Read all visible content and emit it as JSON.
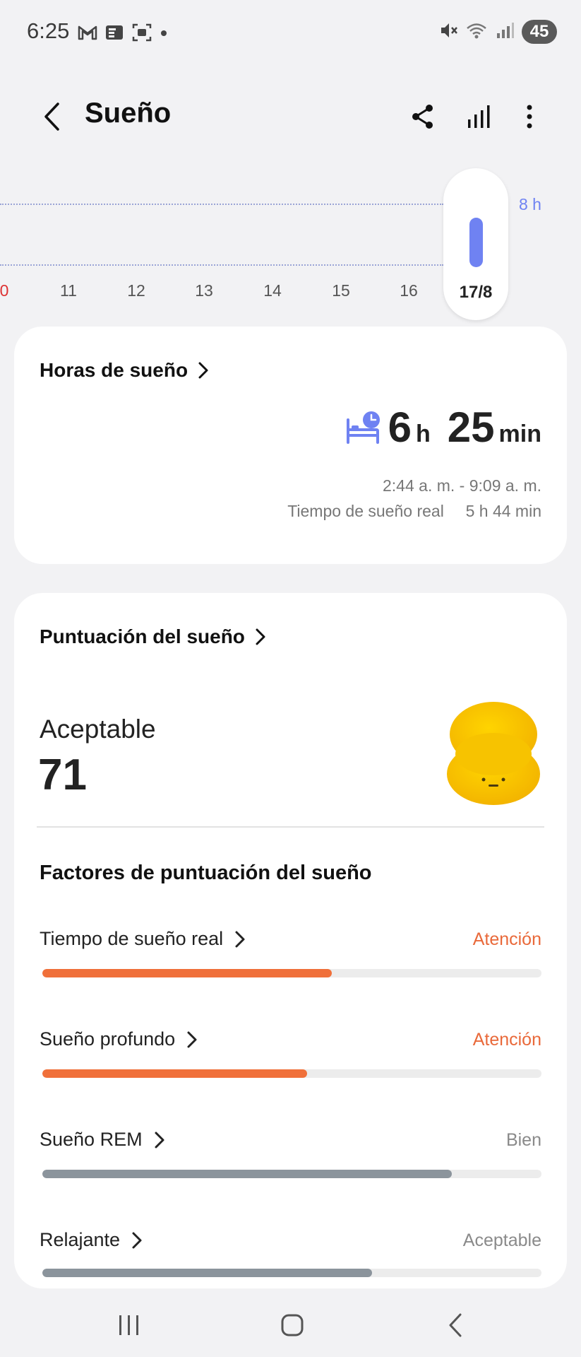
{
  "status_bar": {
    "time": "6:25",
    "left_icons": [
      "gmail-icon",
      "news-icon",
      "screenshot-icon",
      "dot-icon"
    ],
    "right_icons": [
      "mute-icon",
      "wifi-icon",
      "signal-icon"
    ],
    "battery": "45"
  },
  "header": {
    "title": "Sueño",
    "actions": [
      "share-icon",
      "bar-chart-icon",
      "more-icon"
    ]
  },
  "timeline": {
    "days": [
      "0",
      "11",
      "12",
      "13",
      "14",
      "15",
      "16"
    ],
    "selected_day": "17/8",
    "goal_label": "8 h",
    "colors": {
      "bar": "#6f82f2",
      "first_day": "#dd3333"
    }
  },
  "sleep_hours": {
    "title": "Horas de sueño",
    "hours": "6",
    "hours_unit": "h",
    "minutes": "25",
    "minutes_unit": "min",
    "range": "2:44 a. m. - 9:09 a. m.",
    "actual_label": "Tiempo de sueño real",
    "actual_value": "5 h 44 min"
  },
  "sleep_score": {
    "title": "Puntuación del sueño",
    "rating": "Aceptable",
    "score": "71",
    "factors_title": "Factores de puntuación del sueño",
    "factors": [
      {
        "name": "Tiempo de sueño real",
        "status": "Atención",
        "level": 0.58,
        "color": "#f0703a"
      },
      {
        "name": "Sueño profundo",
        "status": "Atención",
        "level": 0.53,
        "color": "#f0703a"
      },
      {
        "name": "Sueño REM",
        "status": "Bien",
        "level": 0.82,
        "color": "#8b949c"
      },
      {
        "name": "Relajante",
        "status": "Aceptable",
        "level": 0.66,
        "color": "#8b949c"
      }
    ],
    "status_colors": {
      "Atención": "#e9693a",
      "Bien": "#8a8a8a",
      "Aceptable": "#8a8a8a"
    }
  },
  "nav_bar": [
    "recents-icon",
    "home-icon",
    "back-icon"
  ]
}
